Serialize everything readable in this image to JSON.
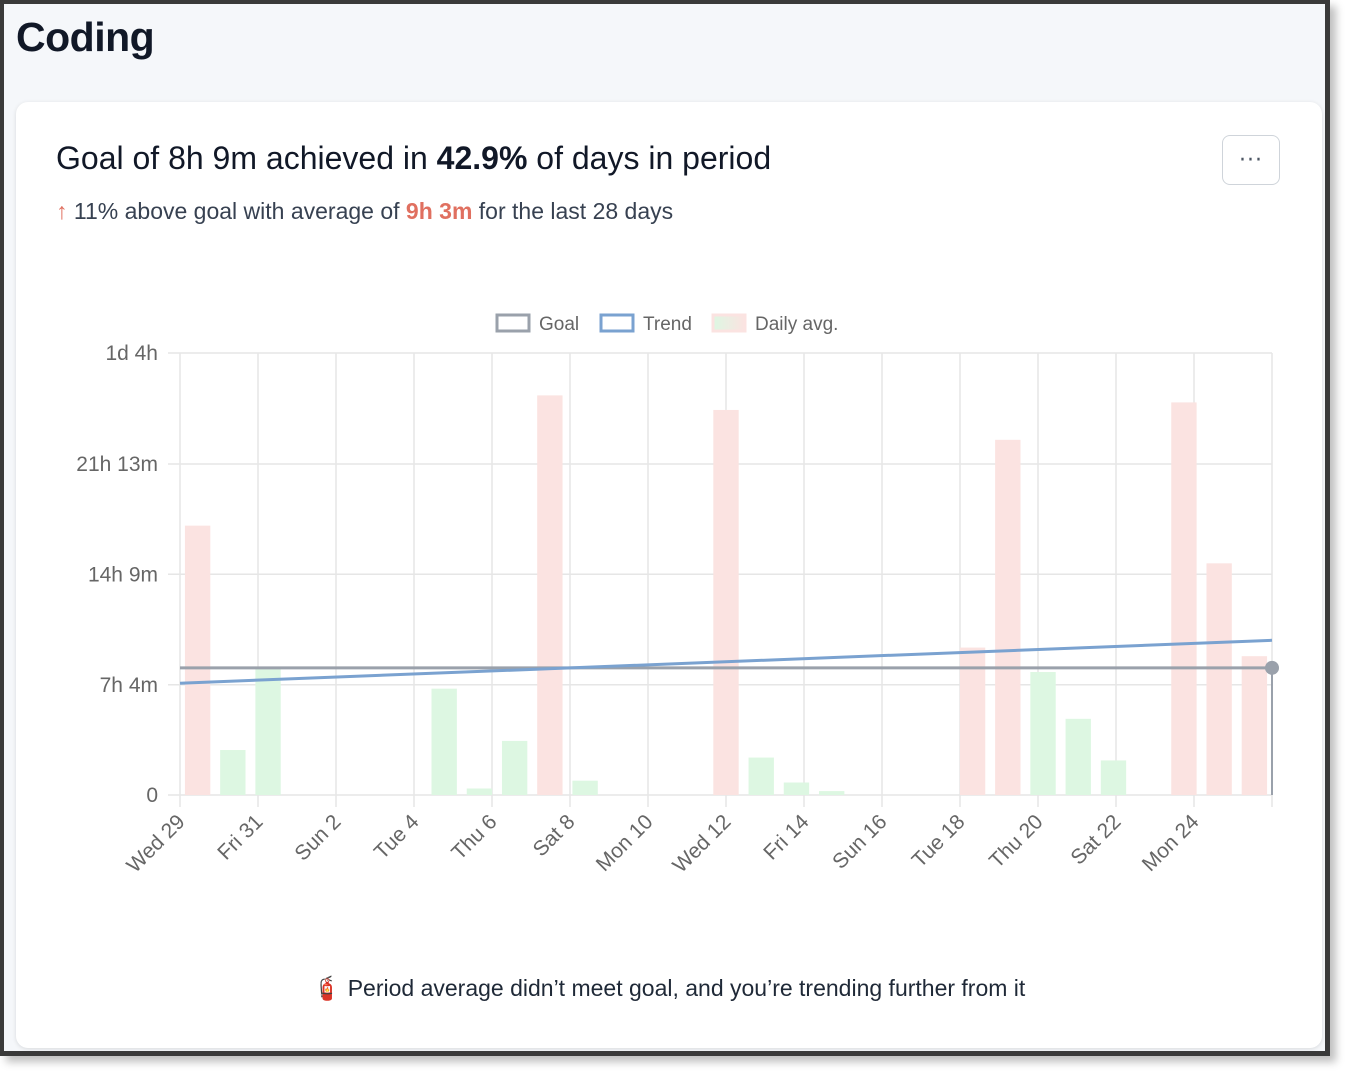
{
  "page": {
    "title": "Coding"
  },
  "card": {
    "headline_prefix": "Goal of 8h 9m achieved in ",
    "headline_value": "42.9%",
    "headline_suffix": " of days in period",
    "sub_arrow": "↑",
    "sub_prefix": " 11% above goal with average of ",
    "sub_value": "9h 3m",
    "sub_suffix": " for the last 28 days",
    "menu_label": "···",
    "footer_icon": "🧯",
    "footer_text": "Period average didn’t meet goal, and you’re trending further from it"
  },
  "colors": {
    "goal_line": "#9aa1ab",
    "trend_line": "#7aa2d0",
    "bar_below_goal": "#ddf7e2",
    "bar_above_goal": "#fbe3e1",
    "grid": "#e6e6e6",
    "accent": "#e07060"
  },
  "chart_data": {
    "type": "bar",
    "legend": [
      "Goal",
      "Trend",
      "Daily avg."
    ],
    "legend_position": "top",
    "y_unit": "minutes",
    "ylim": [
      0,
      1700
    ],
    "y_ticks": [
      {
        "value": 0,
        "label": "0"
      },
      {
        "value": 424,
        "label": "7h 4m"
      },
      {
        "value": 849,
        "label": "14h 9m"
      },
      {
        "value": 1273,
        "label": "21h 13m"
      },
      {
        "value": 1700,
        "label": "1d 4h"
      }
    ],
    "x_tick_labels": [
      "Wed 29",
      "Fri 31",
      "Sun 2",
      "Tue 4",
      "Thu 6",
      "Sat 8",
      "Mon 10",
      "Wed 12",
      "Fri 14",
      "Sun 16",
      "Tue 18",
      "Thu 20",
      "Sat 22",
      "Mon 24"
    ],
    "goal_minutes": 489,
    "trend": {
      "start": 430,
      "end": 595
    },
    "days": 28,
    "values": [
      1036,
      173,
      486,
      0,
      0,
      0,
      0,
      409,
      25,
      208,
      1537,
      55,
      0,
      0,
      0,
      1481,
      144,
      48,
      15,
      0,
      0,
      0,
      567,
      1366,
      473,
      293,
      133,
      0,
      1510,
      891,
      534
    ]
  }
}
